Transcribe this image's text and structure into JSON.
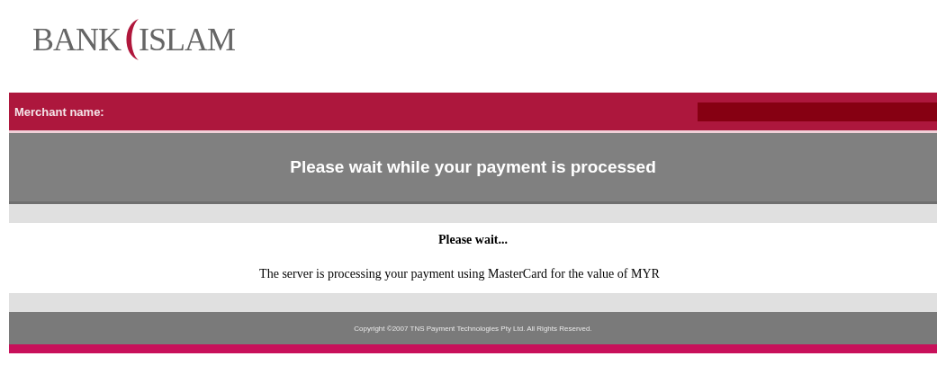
{
  "logo": {
    "left": "BANK",
    "right": "ISLAM"
  },
  "merchant_bar": {
    "label": "Merchant name:"
  },
  "banner": {
    "title": "Please wait while your payment is processed"
  },
  "message": {
    "heading": "Please wait...",
    "text": "The server is processing your payment using MasterCard for the value of MYR"
  },
  "footer": {
    "copyright": "Copyright ©2007 TNS Payment Technologies Pty Ltd. All Rights Reserved."
  }
}
